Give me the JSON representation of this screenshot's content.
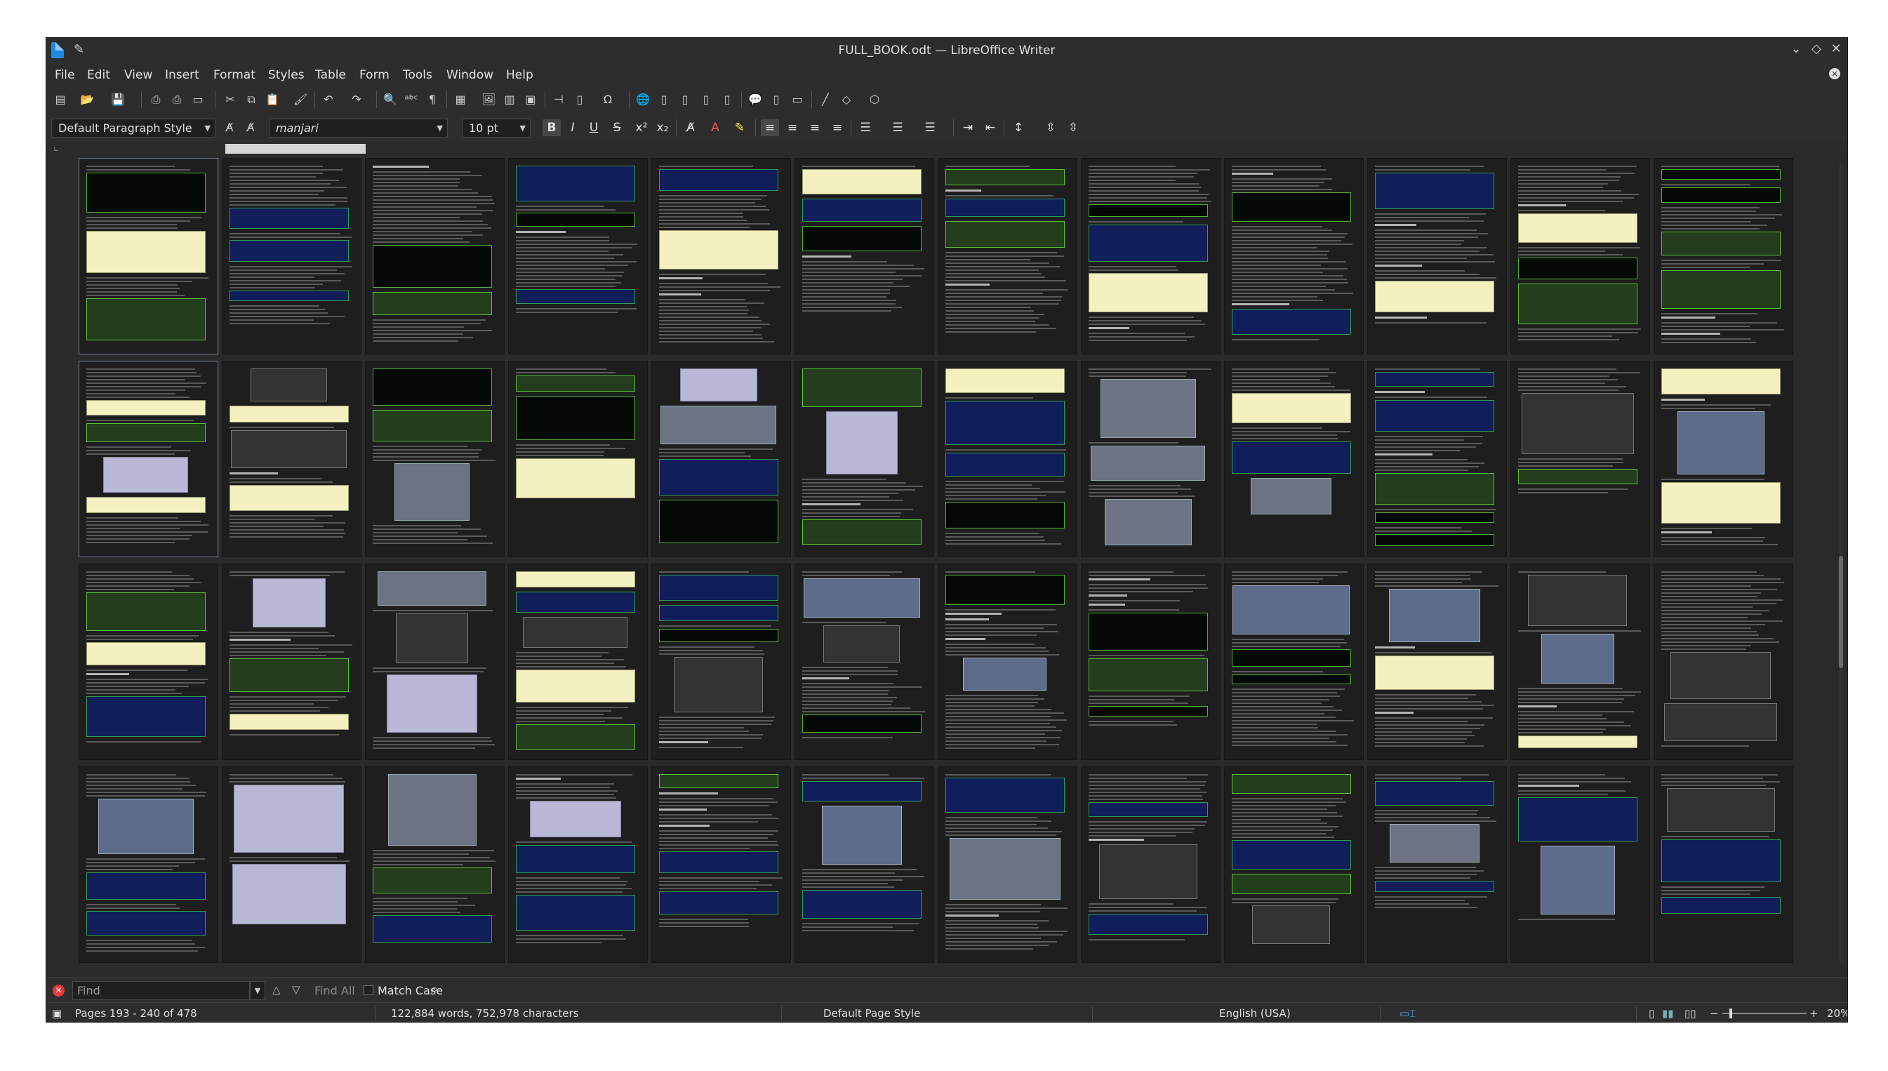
{
  "window": {
    "title": "FULL_BOOK.odt — LibreOffice Writer"
  },
  "menu": [
    "File",
    "Edit",
    "View",
    "Insert",
    "Format",
    "Styles",
    "Table",
    "Form",
    "Tools",
    "Window",
    "Help"
  ],
  "formatting": {
    "paragraph_style": "Default Paragraph Style",
    "font_name": "manjari",
    "font_size": "10 pt"
  },
  "find": {
    "placeholder": "Find",
    "find_all": "Find All",
    "match_case": "Match Case"
  },
  "status": {
    "pages": "Pages 193 - 240 of 478",
    "word_count": "122,884 words, 752,978 characters",
    "page_style": "Default Page Style",
    "language": "English (USA)",
    "zoom": "20%"
  },
  "colors": {
    "background": "#2b2b2b",
    "code_block_green": "#243d1d",
    "code_block_blue": "#101e5a",
    "accent": "#5cbf3a"
  }
}
